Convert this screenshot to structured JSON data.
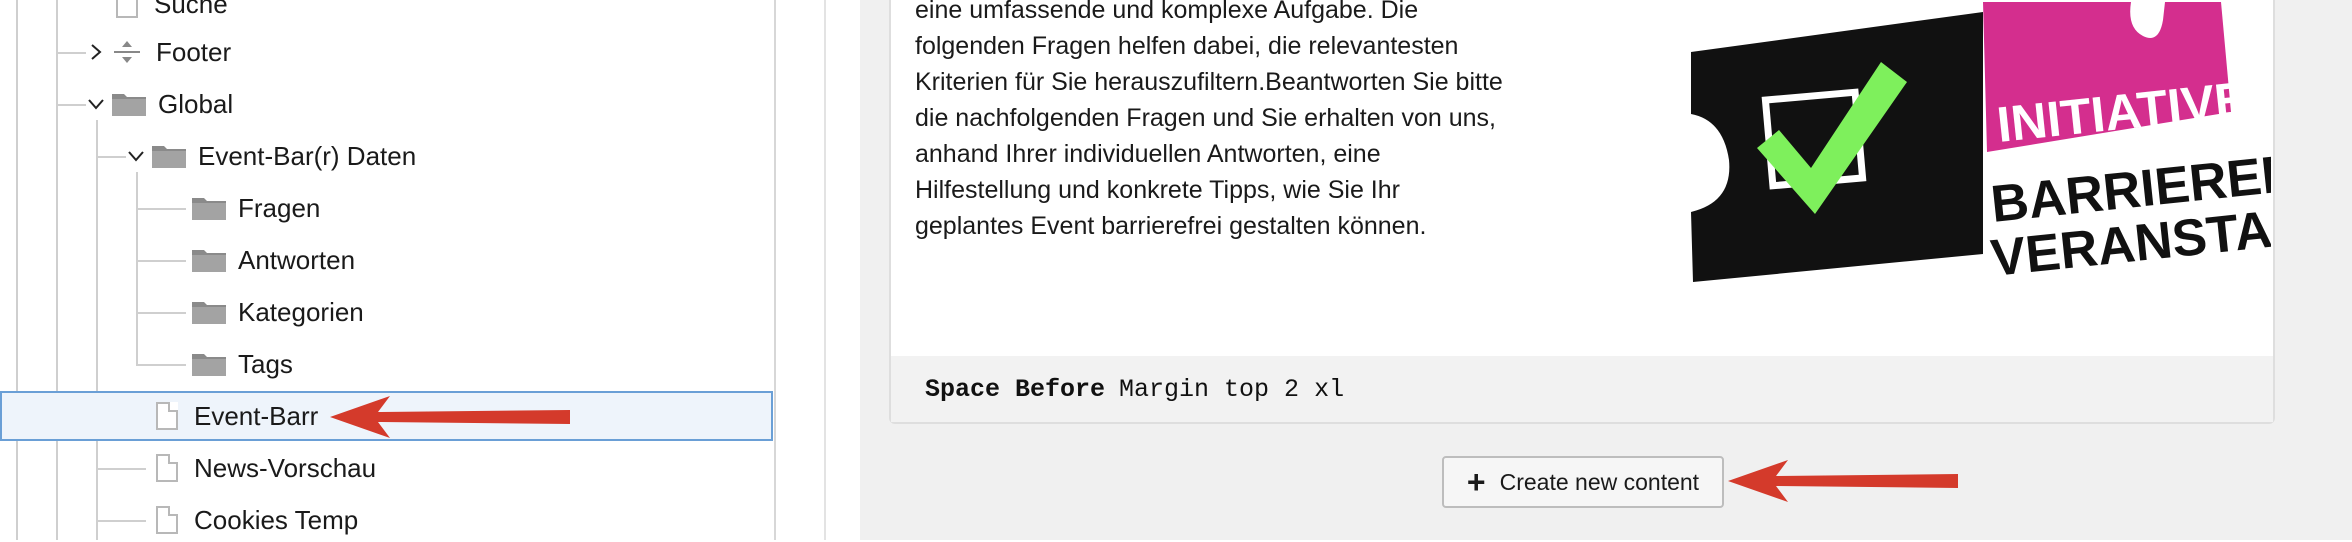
{
  "tree": {
    "items": [
      {
        "label": "Suche",
        "icon": "page-icon"
      },
      {
        "label": "Footer",
        "icon": "separator-icon"
      },
      {
        "label": "Global",
        "icon": "folder-icon"
      },
      {
        "label": "Event-Bar(r) Daten",
        "icon": "folder-icon"
      },
      {
        "label": "Fragen",
        "icon": "folder-icon"
      },
      {
        "label": "Antworten",
        "icon": "folder-icon"
      },
      {
        "label": "Kategorien",
        "icon": "folder-icon"
      },
      {
        "label": "Tags",
        "icon": "folder-icon"
      },
      {
        "label": "Event-Barr",
        "icon": "page-icon",
        "selected": true
      },
      {
        "label": "News-Vorschau",
        "icon": "page-icon"
      },
      {
        "label": "Cookies Temp",
        "icon": "page-icon"
      }
    ]
  },
  "content_element": {
    "text_lines": [
      "eine umfassende und komplexe Aufgabe. Die",
      "folgenden Fragen helfen dabei, die relevantesten",
      "Kriterien für Sie herauszufiltern.Beantworten Sie bitte",
      "die nachfolgenden Fragen und Sie erhalten von uns,",
      "anhand Ihrer individuellen Antworten, eine",
      "Hilfestellung und konkrete Tipps, wie Sie Ihr",
      "geplantes Event barrierefrei gestalten können."
    ],
    "logo": {
      "lines": [
        "INITIATIVE",
        "BARRIEREFREI",
        "VERANSTALTEN"
      ],
      "colors": {
        "pink": "#d42e8e",
        "green": "#7ef05c",
        "black": "#111111"
      }
    },
    "footer": {
      "key": "Space Before",
      "value": "Margin top 2 xl"
    }
  },
  "actions": {
    "create_label": "Create new content"
  },
  "colors": {
    "arrow": "#d43a2b",
    "selection_border": "#6a9fd6"
  }
}
